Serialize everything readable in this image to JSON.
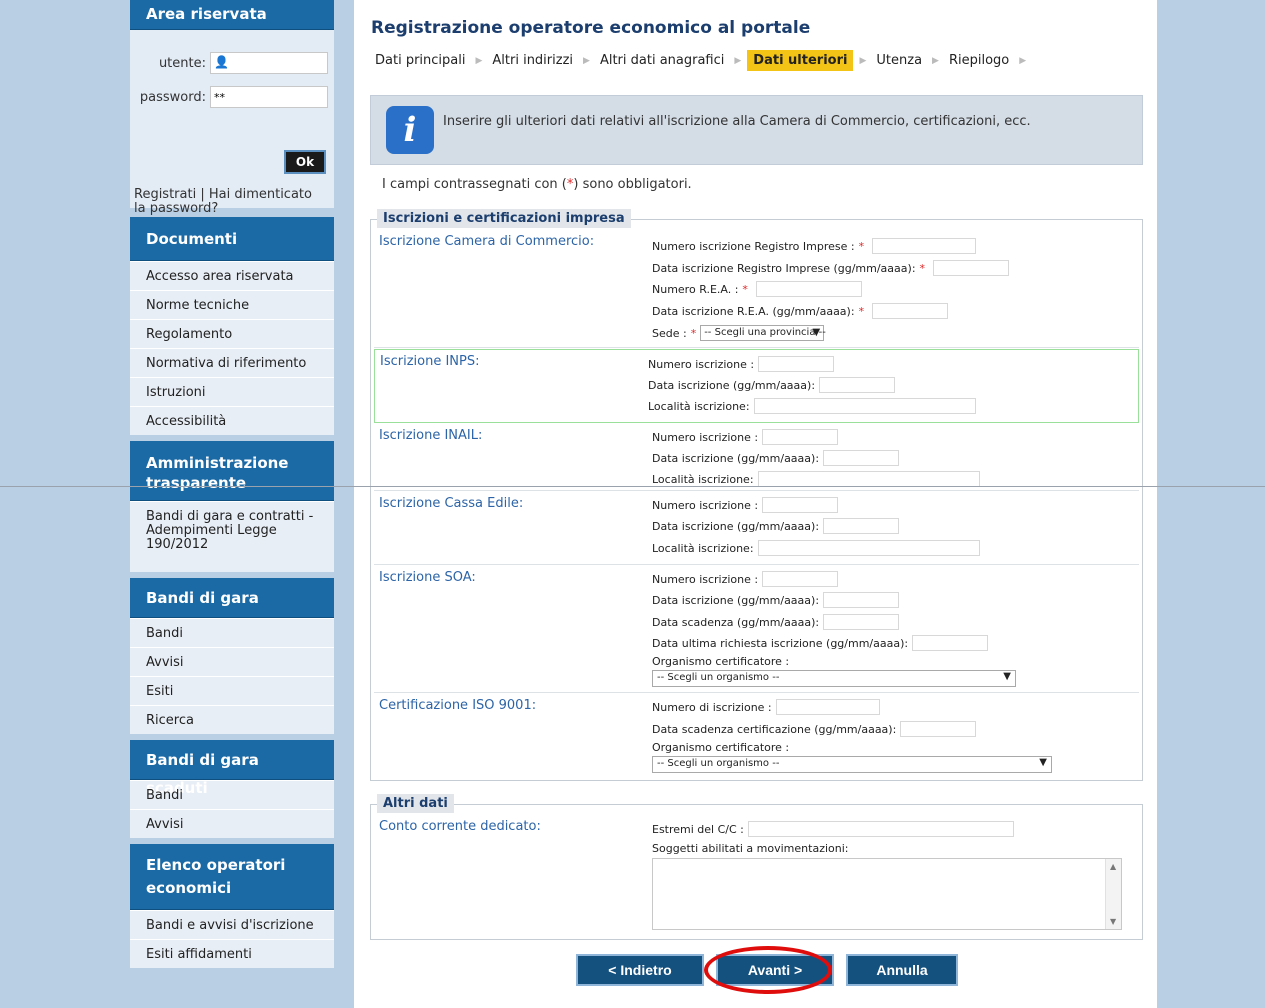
{
  "sidebar": {
    "login": {
      "title": "Area riservata",
      "user_label": "utente:",
      "password_label": "password:",
      "password_value": "**",
      "ok_label": "Ok",
      "links_text": "Registrati | Hai dimenticato la password?"
    },
    "documents": {
      "title": "Documenti",
      "items": [
        "Accesso area riservata",
        "Norme tecniche",
        "Regolamento",
        "Normativa di riferimento",
        "Istruzioni",
        "Accessibilità"
      ]
    },
    "transparency": {
      "title": "Amministrazione trasparente",
      "items": [
        "Bandi di gara e contratti - Adempimenti Legge 190/2012"
      ]
    },
    "tenders": {
      "title": "Bandi di gara",
      "items": [
        "Bandi",
        "Avvisi",
        "Esiti",
        "Ricerca"
      ]
    },
    "expired": {
      "title": "Bandi di gara scaduti",
      "items": [
        "Bandi",
        "Avvisi"
      ]
    },
    "operators": {
      "title": "Elenco operatori economici",
      "items": [
        "Bandi e avvisi d'iscrizione",
        "Esiti affidamenti"
      ]
    }
  },
  "main": {
    "title": "Registrazione operatore economico al portale",
    "wizard": [
      "Dati principali",
      "Altri indirizzi",
      "Altri dati anagrafici",
      "Dati ulteriori",
      "Utenza",
      "Riepilogo"
    ],
    "active_step": "Dati ulteriori",
    "info": "Inserire gli ulteriori dati relativi all'iscrizione alla Camera di Commercio, certificazioni, ecc.",
    "mandatory_pre": "I campi contrassegnati con (",
    "mandatory_star": "*",
    "mandatory_post": ") sono obbligatori.",
    "req_mark": "*",
    "fieldset1": {
      "legend": "Iscrizioni e certificazioni impresa",
      "ccia": {
        "title": "Iscrizione Camera di Commercio:",
        "numero_reg": "Numero iscrizione Registro Imprese :",
        "data_reg": "Data iscrizione Registro Imprese (gg/mm/aaaa):",
        "numero_rea": "Numero R.E.A. :",
        "data_rea": "Data iscrizione R.E.A. (gg/mm/aaaa):",
        "sede": "Sede :",
        "sede_select": "-- Scegli una provincia --"
      },
      "inps": {
        "title": "Iscrizione INPS:",
        "numero": "Numero iscrizione :",
        "data": "Data iscrizione (gg/mm/aaaa):",
        "localita": "Località iscrizione:"
      },
      "inail": {
        "title": "Iscrizione INAIL:",
        "numero": "Numero iscrizione :",
        "data": "Data iscrizione (gg/mm/aaaa):",
        "localita": "Località iscrizione:"
      },
      "cassa": {
        "title": "Iscrizione Cassa Edile:",
        "numero": "Numero iscrizione :",
        "data": "Data iscrizione (gg/mm/aaaa):",
        "localita": "Località iscrizione:"
      },
      "soa": {
        "title": "Iscrizione SOA:",
        "numero": "Numero iscrizione :",
        "data": "Data iscrizione (gg/mm/aaaa):",
        "scadenza": "Data scadenza (gg/mm/aaaa):",
        "ultima": "Data ultima richiesta iscrizione (gg/mm/aaaa):",
        "organismo": "Organismo certificatore :",
        "organismo_select": "-- Scegli un organismo --"
      },
      "iso": {
        "title": "Certificazione ISO 9001:",
        "numero": "Numero di iscrizione :",
        "scadenza": "Data scadenza certificazione (gg/mm/aaaa):",
        "organismo": "Organismo certificatore :",
        "organismo_select": "-- Scegli un organismo --"
      }
    },
    "fieldset2": {
      "legend": "Altri dati",
      "conto": {
        "title": "Conto corrente dedicato:",
        "estremi": "Estremi del C/C :",
        "soggetti": "Soggetti abilitati a movimentazioni:"
      }
    },
    "buttons": {
      "back": "< Indietro",
      "next": "Avanti >",
      "cancel": "Annulla"
    },
    "highlight_color": "#e00d0d"
  }
}
